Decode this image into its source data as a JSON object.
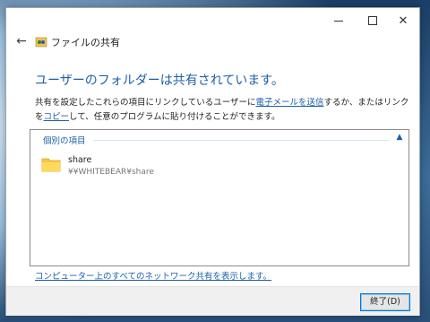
{
  "window": {
    "title": "ファイルの共有",
    "minimize_icon": "minimize-icon",
    "maximize_icon": "maximize-icon",
    "close_icon": "close-icon"
  },
  "nav": {
    "back_icon": "back-arrow-icon"
  },
  "heading": "ユーザーのフォルダーは共有されています。",
  "description": {
    "part1": "共有を設定したこれらの項目にリンクしているユーザーに",
    "link_email": "電子メールを送信",
    "part2": "するか、またはリンクを",
    "link_copy": "コピー",
    "part3": "して、任意のプログラムに貼り付けることができます。"
  },
  "list": {
    "group_label": "個別の項目",
    "collapse_icon": "chevron-up-icon",
    "items": [
      {
        "name": "share",
        "path": "¥¥WHITEBEAR¥share",
        "icon": "folder-icon"
      }
    ]
  },
  "network_link": "コンピューター上のすべてのネットワーク共有を表示します。",
  "footer": {
    "close_label": "終了(D)"
  },
  "colors": {
    "accent": "#1b5faa",
    "button_border": "#0078d7"
  }
}
